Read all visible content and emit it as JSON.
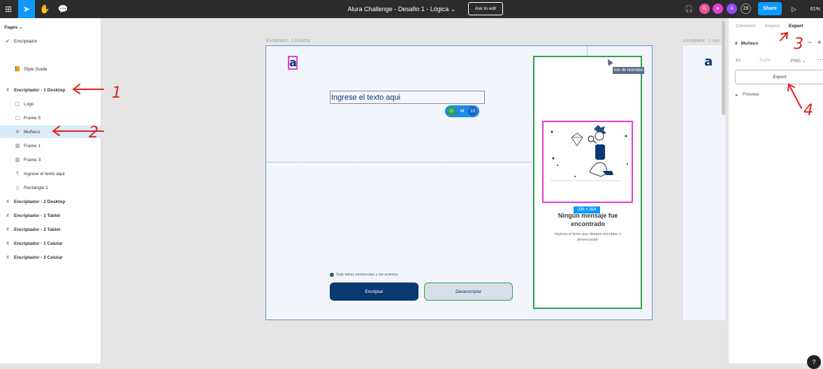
{
  "topbar": {
    "title": "Alura Challenge - Desafio 1 - Lógica",
    "ask_to_edit": "Ask to edit",
    "avatars": [
      {
        "letter": "G",
        "color": "#f24e9f"
      },
      {
        "letter": "",
        "color": "#e23fd3"
      },
      {
        "letter": "A",
        "color": "#9747ff"
      }
    ],
    "collaborator_count": "29",
    "share": "Share",
    "zoom": "61%"
  },
  "left_panel": {
    "pages_header": "Pages",
    "current_page": "Encriptador",
    "style_guide": "Style Guide",
    "layers": [
      {
        "label": "Encriptador - 1 Desktop",
        "icon": "#",
        "bold": true,
        "sub": false,
        "selected": false
      },
      {
        "label": "Logo",
        "icon": "▢",
        "bold": false,
        "sub": true,
        "selected": false
      },
      {
        "label": "Frame 5",
        "icon": "▢",
        "bold": false,
        "sub": true,
        "selected": false
      },
      {
        "label": "Muñeco",
        "icon": "#",
        "bold": false,
        "sub": true,
        "selected": true
      },
      {
        "label": "Frame 1",
        "icon": "▥",
        "bold": false,
        "sub": true,
        "selected": false
      },
      {
        "label": "Frame 3",
        "icon": "▥",
        "bold": false,
        "sub": true,
        "selected": false
      },
      {
        "label": "Ingrese el texto aqui",
        "icon": "T",
        "bold": false,
        "sub": true,
        "selected": false
      },
      {
        "label": "Rectangle 1",
        "icon": "▯",
        "bold": false,
        "sub": true,
        "selected": false
      },
      {
        "label": "Encriptador - 2 Desktop",
        "icon": "#",
        "bold": true,
        "sub": false,
        "selected": false
      },
      {
        "label": "Encriptador - 1 Tablet",
        "icon": "#",
        "bold": true,
        "sub": false,
        "selected": false
      },
      {
        "label": "Encriptador - 2 Tablet",
        "icon": "#",
        "bold": true,
        "sub": false,
        "selected": false
      },
      {
        "label": "Encriptador - 1 Celular",
        "icon": "#",
        "bold": true,
        "sub": false,
        "selected": false
      },
      {
        "label": "Encriptador - 2 Celular",
        "icon": "#",
        "bold": true,
        "sub": false,
        "selected": false
      }
    ]
  },
  "canvas": {
    "frame1_label": "Encriptador - 1 Desktop",
    "frame2_label": "Encriptador - 2 Des",
    "logo": "a",
    "input_text": "Ingrese el texto aqui",
    "collab_badges": [
      {
        "letter": "G",
        "color": "#2da44e"
      },
      {
        "letter": "M",
        "color": "#1b8be8"
      },
      {
        "letter": "23",
        "color": "#1565c0"
      }
    ],
    "cursor_label": "luis de leonidas",
    "dimension_badge": "336 × 304",
    "card_title": "Ningún mensaje fue encontrado",
    "card_desc": "Ingresa el texto que desees encriptar o desencriptar.",
    "note": "Solo letras minúsculas y sin acentos",
    "encrypt_button": "Encriptar",
    "decrypt_button": "Desencriptar"
  },
  "right_panel": {
    "tabs": [
      "Comment",
      "Inspect",
      "Export"
    ],
    "active_tab": "Export",
    "layer_name": "Muñeco",
    "scale": "1x",
    "suffix_placeholder": "Suffix",
    "format": "PNG",
    "export_button": "Export",
    "preview": "Preview"
  },
  "annotations": [
    "1",
    "2",
    "3",
    "4"
  ],
  "help": "?"
}
